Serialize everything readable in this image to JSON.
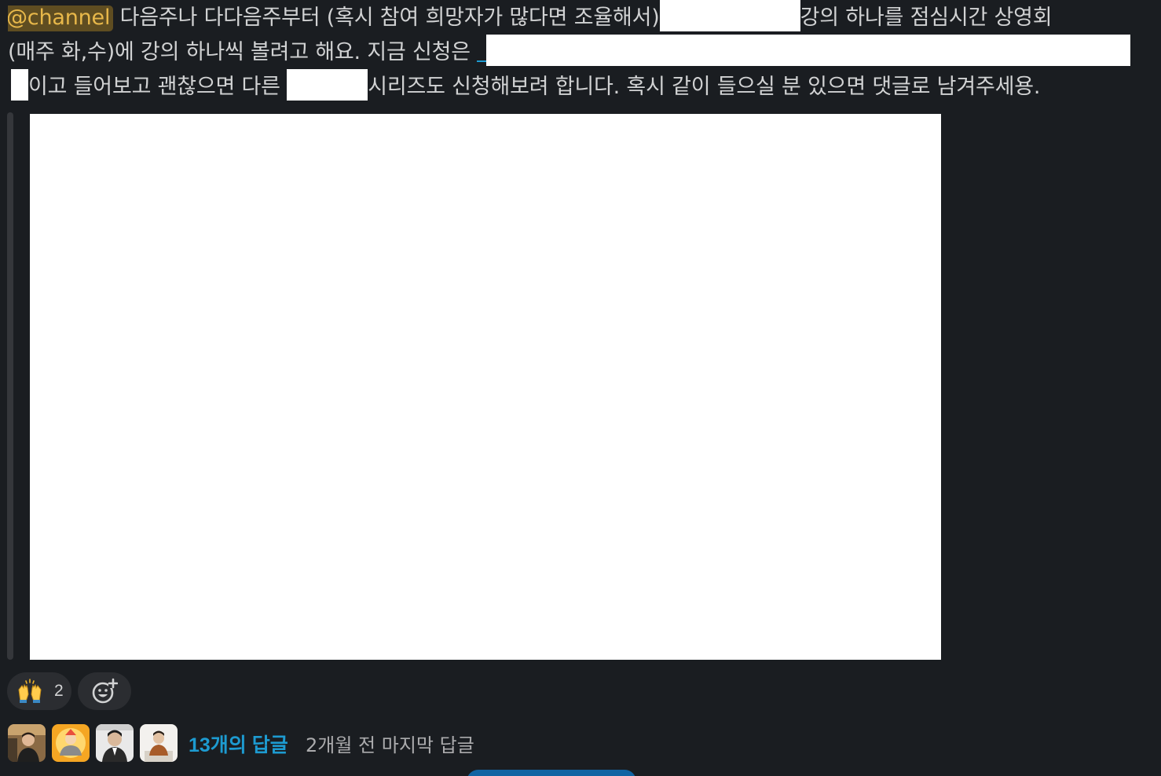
{
  "message": {
    "mention": "@channel",
    "line1": " 다음주나 다다음주부터 (혹시 참여 희망자가 많다면 조율해서)",
    "line1b": "강의 하나를 점심시간 상영회",
    "line2": "(매주 화,수)에 강의 하나씩 볼려고 해요. 지금 신청은 ",
    "line3a": "이고 들어보고 괜찮으면 다른 ",
    "line3b": "시리즈도 신청해보려 합니다. 혹시 같이 들으실 분 있으면 댓글로 남겨주세용."
  },
  "reactions": [
    {
      "emoji": "raised-hands",
      "count": "2"
    }
  ],
  "thread": {
    "reply_count": "13개의 답글",
    "last_reply": "2개월 전 마지막 답글"
  },
  "colors": {
    "background": "#1a1d21",
    "mention_bg": "#5f4d21",
    "mention_text": "#e8b84a",
    "link": "#1d9bd1",
    "reaction_bg": "#2b2d31"
  }
}
